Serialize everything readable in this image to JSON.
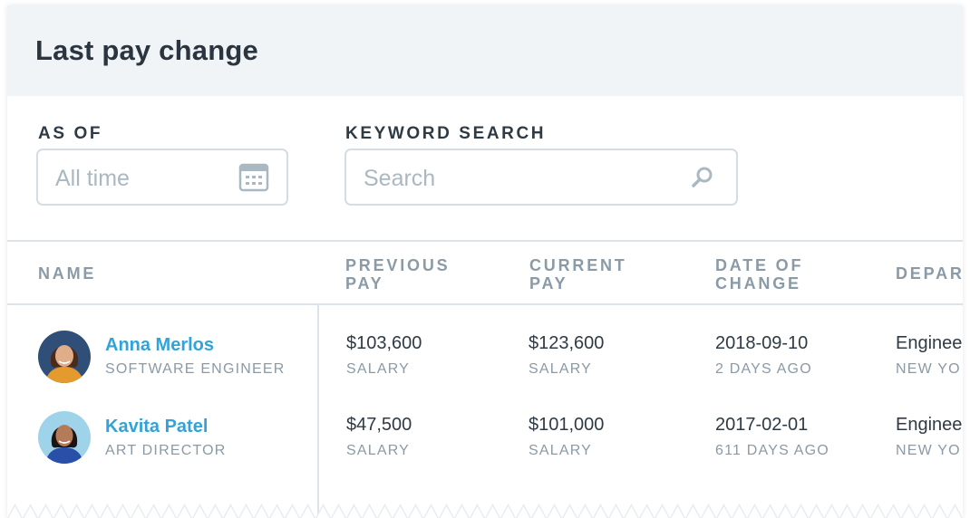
{
  "header": {
    "title": "Last pay change"
  },
  "filters": {
    "as_of_label": "AS OF",
    "as_of_placeholder": "All time",
    "as_of_icon": "calendar-icon",
    "keyword_label": "KEYWORD SEARCH",
    "keyword_placeholder": "Search",
    "keyword_icon": "search-icon"
  },
  "table": {
    "columns": {
      "name": "NAME",
      "previous_pay": "PREVIOUS\nPAY",
      "current_pay": "CURRENT\nPAY",
      "date_of_change": "DATE OF\nCHANGE",
      "department": "DEPAR"
    },
    "rows": [
      {
        "name": "Anna Merlos",
        "title": "SOFTWARE ENGINEER",
        "previous_pay": "$103,600",
        "previous_type": "SALARY",
        "current_pay": "$123,600",
        "current_type": "SALARY",
        "date": "2018-09-10",
        "ago": "2 DAYS AGO",
        "department": "Enginee",
        "location": "NEW YO"
      },
      {
        "name": "Kavita Patel",
        "title": "ART DIRECTOR",
        "previous_pay": "$47,500",
        "previous_type": "SALARY",
        "current_pay": "$101,000",
        "current_type": "SALARY",
        "date": "2017-02-01",
        "ago": "611 DAYS AGO",
        "department": "Enginee",
        "location": "NEW YO"
      }
    ]
  },
  "colors": {
    "link": "#31a3d8",
    "header_bg": "#f0f4f7",
    "muted": "#8a9aa6",
    "border": "#d3dde3"
  }
}
